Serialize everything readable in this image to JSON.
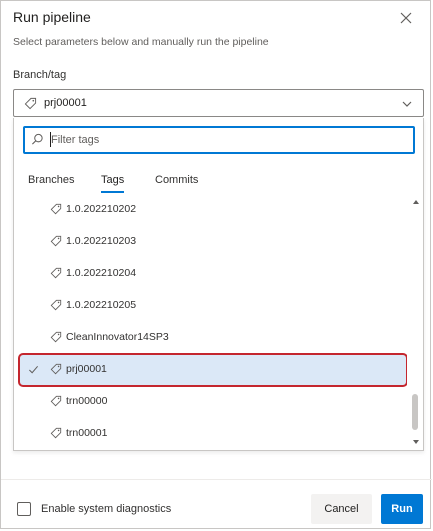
{
  "dialog": {
    "title": "Run pipeline",
    "subtitle": "Select parameters below and manually run the pipeline",
    "close_icon": "close-icon"
  },
  "branch_field": {
    "label": "Branch/tag",
    "value": "prj00001",
    "icon": "tag-icon"
  },
  "dropdown": {
    "filter_placeholder": "Filter tags",
    "filter_value": "",
    "tabs": [
      {
        "label": "Branches",
        "active": false
      },
      {
        "label": "Tags",
        "active": true
      },
      {
        "label": "Commits",
        "active": false
      }
    ],
    "items": [
      {
        "label": "1.0.202210202",
        "selected": false
      },
      {
        "label": "1.0.202210203",
        "selected": false
      },
      {
        "label": "1.0.202210204",
        "selected": false
      },
      {
        "label": "1.0.202210205",
        "selected": false
      },
      {
        "label": "CleanInnovator14SP3",
        "selected": false
      },
      {
        "label": "prj00001",
        "selected": true
      },
      {
        "label": "trn00000",
        "selected": false
      },
      {
        "label": "trn00001",
        "selected": false
      }
    ]
  },
  "footer": {
    "diagnostics_label": "Enable system diagnostics",
    "diagnostics_checked": false,
    "cancel_label": "Cancel",
    "run_label": "Run"
  },
  "colors": {
    "accent": "#0078d4",
    "selected_row_bg": "#dbe8f7",
    "highlight_border": "#c4262e"
  }
}
